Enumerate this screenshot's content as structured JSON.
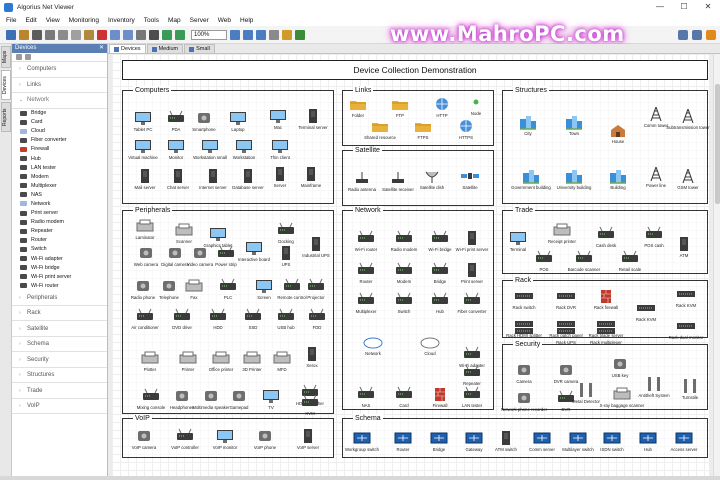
{
  "window": {
    "title": "Algorius Net Viewer",
    "controls": [
      "—",
      "☐",
      "✕"
    ]
  },
  "menu": [
    "File",
    "Edit",
    "View",
    "Monitoring",
    "Inventory",
    "Tools",
    "Map",
    "Server",
    "Web",
    "Help"
  ],
  "toolbar": {
    "zoom": "100%"
  },
  "promo": "www.MahroPC.com",
  "left_tabs": [
    "Maps",
    "Devices",
    "Reports"
  ],
  "sidebar": {
    "title": "Devices",
    "categories_top": [
      "Computers",
      "Links",
      "Network"
    ],
    "network_items": [
      "Bridge",
      "Card",
      "Cloud",
      "Fiber converter",
      "Firewall",
      "Hub",
      "LAN tester",
      "Modem",
      "Multiplexer",
      "NAS",
      "Network",
      "Print server",
      "Radio modem",
      "Repeater",
      "Router",
      "Switch",
      "Wi-Fi adapter",
      "Wi-Fi bridge",
      "Wi-Fi print server",
      "Wi-Fi router"
    ],
    "categories_bottom": [
      "Peripherals",
      "Rack",
      "Satellite",
      "Schema",
      "Security",
      "Structures",
      "Trade",
      "VoIP"
    ]
  },
  "doc_tabs": [
    "Devices",
    "Medium",
    "Small"
  ],
  "diagram": {
    "title": "Device Collection Demonstration",
    "groups": [
      {
        "name": "Computers",
        "items": [
          "Tablet PC",
          "PDA",
          "Smartphone",
          "Laptop",
          "Mac",
          "Terminal server",
          "Virtual machine",
          "Monitor",
          "Workstation small",
          "Workstation",
          "Thin client",
          "Mail server",
          "Chat server",
          "Internet server",
          "Database server",
          "Server",
          "Mainframe"
        ]
      },
      {
        "name": "Links",
        "items": [
          "Folder",
          "FTP",
          "HTTP",
          "Node",
          "Shared resource",
          "FTPS",
          "HTTPS"
        ]
      },
      {
        "name": "Satellite",
        "items": [
          "Radio antenna",
          "Satellite receiver",
          "Satellite dish",
          "Satellite"
        ]
      },
      {
        "name": "Structures",
        "items": [
          "City",
          "Town",
          "House",
          "Comm tower",
          "Subtransmission tower",
          "Government building",
          "University building",
          "Building",
          "Power line",
          "GSM tower"
        ]
      },
      {
        "name": "Peripherals",
        "items": [
          "Laminator",
          "Scanner",
          "Graphics tablet",
          "Docking",
          "Web camera",
          "Digital camera",
          "Video camera",
          "Power strip",
          "Interactive board",
          "UPS",
          "Industrial UPS",
          "Radio phone",
          "Telephone",
          "Fax",
          "PLC",
          "Screen",
          "Remote control",
          "Projector",
          "Air conditioner",
          "DVD drive",
          "HDD",
          "SSD",
          "USB hub",
          "FDD",
          "Plotter",
          "Printer",
          "Office printer",
          "3D Printer",
          "MFD",
          "Xerox",
          "Mixing console",
          "Headphones",
          "Multimedia speaker",
          "Gamepad",
          "TV",
          "HDMI switcher",
          "KVM"
        ]
      },
      {
        "name": "Network",
        "items": [
          "Wi-Fi router",
          "Radio modem",
          "Wi-Fi bridge",
          "Wi-Fi print server",
          "Router",
          "Modem",
          "Bridge",
          "Print server",
          "Multiplexer",
          "Switch",
          "Hub",
          "Fiber converter",
          "Network",
          "Cloud",
          "Wi-Fi adapter",
          "Repeater",
          "NAS",
          "Card",
          "Firewall",
          "LAN tester"
        ]
      },
      {
        "name": "Trade",
        "items": [
          "Terminal",
          "Receipt printer",
          "Cash desk",
          "POS cash",
          "POS",
          "Barcode scanner",
          "Retail scale",
          "ATM"
        ]
      },
      {
        "name": "Rack",
        "items": [
          "Rack switch",
          "Rack DVR",
          "Rack firewall",
          "Rack KVM",
          "Rack HDMI splitter",
          "Rack patch panel",
          "Rack blade server",
          "Rack KVM",
          "Rack ATS",
          "Rack UPS",
          "Rack multiplexer",
          "Rack dual monitor"
        ]
      },
      {
        "name": "Security",
        "items": [
          "Camera",
          "DVR camera",
          "USB key",
          "Network phone recorder",
          "DVR",
          "Metal Detector",
          "X-ray baggage scanner",
          "Antitheft System",
          "Turnstile"
        ]
      },
      {
        "name": "VoIP",
        "items": [
          "VoIP camera",
          "VoIP controller",
          "VoIP monitor",
          "VoIP phone",
          "VoIP server"
        ]
      },
      {
        "name": "Schema",
        "items": [
          "Workgroup switch",
          "Router",
          "Bridge",
          "Gateway",
          "ATM switch",
          "Comm server",
          "Multilayer switch",
          "ISDN switch",
          "Hub",
          "Access server"
        ]
      }
    ]
  },
  "colors": {
    "accent": "#4b72b3",
    "sidebar_header": "#5b7fb3",
    "promo_glow": "#d44ce0",
    "building": "#3b8fd9"
  }
}
